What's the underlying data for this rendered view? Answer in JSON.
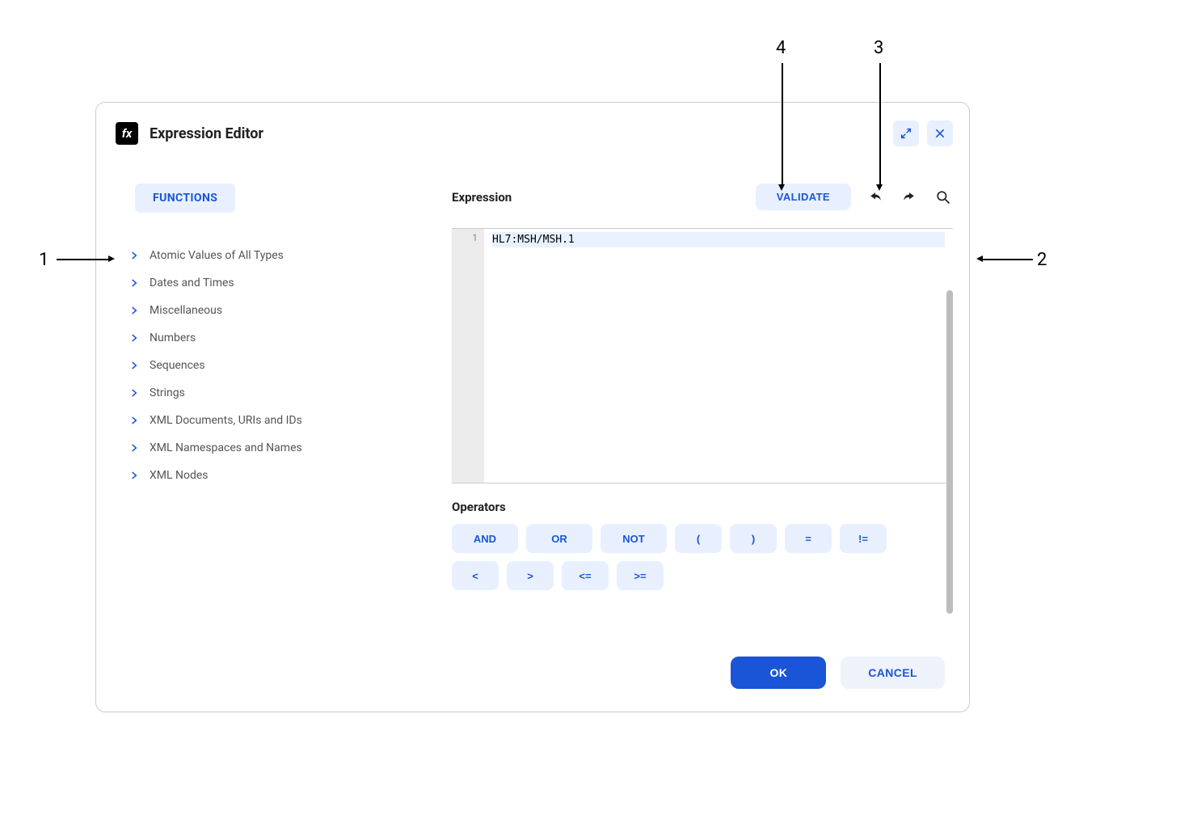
{
  "dialog": {
    "title": "Expression Editor"
  },
  "functions_tab": "FUNCTIONS",
  "function_categories": [
    "Atomic Values of All Types",
    "Dates and Times",
    "Miscellaneous",
    "Numbers",
    "Sequences",
    "Strings",
    "XML Documents, URIs and IDs",
    "XML Namespaces and Names",
    "XML Nodes"
  ],
  "expression": {
    "label": "Expression",
    "validate_label": "VALIDATE",
    "line_number": "1",
    "code": "HL7:MSH/MSH.1"
  },
  "operators": {
    "label": "Operators",
    "items": [
      "AND",
      "OR",
      "NOT",
      "(",
      ")",
      "=",
      "!=",
      "<",
      ">",
      "<=",
      ">="
    ]
  },
  "footer": {
    "ok": "OK",
    "cancel": "CANCEL"
  },
  "annotations": {
    "n1": "1",
    "n2": "2",
    "n3": "3",
    "n4": "4"
  }
}
